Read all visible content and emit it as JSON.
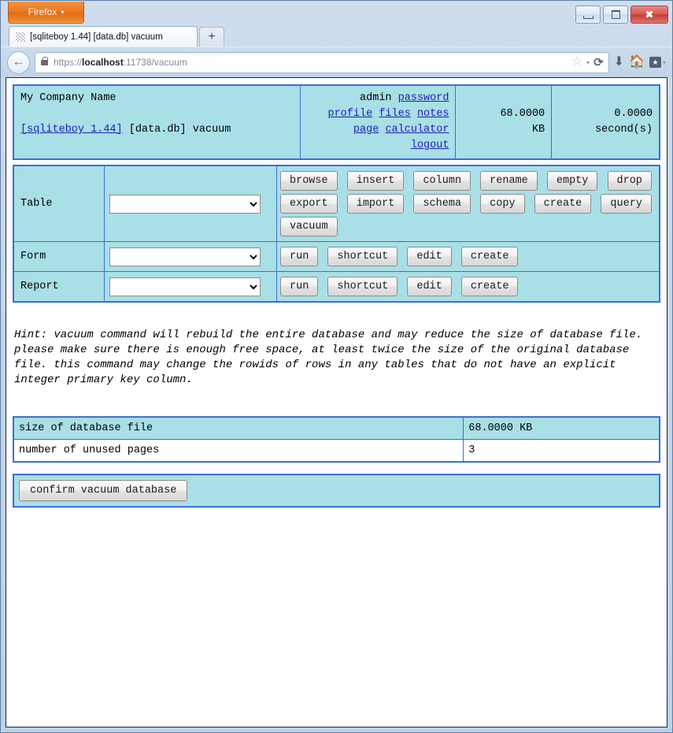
{
  "browser": {
    "app_button_label": "Firefox",
    "app_button_caret": "▾",
    "tab_title": "[sqliteboy 1.44] [data.db] vacuum",
    "new_tab_label": "+",
    "back_icon": "←",
    "url_scheme": "https://",
    "url_host": "localhost",
    "url_rest": ":11738/vacuum",
    "url_full": "https://localhost:11738/vacuum",
    "star_icon": "☆",
    "star_caret": "▾",
    "reload_icon": "⟳",
    "download_icon": "⬇",
    "home_icon": "🏠",
    "bookmark_icon": "★",
    "bookmark_caret": "▾",
    "window_controls": {
      "minimize": "minimize",
      "maximize": "maximize",
      "close": "✖"
    }
  },
  "header": {
    "company_name": "My Company Name",
    "app_link": "[sqliteboy 1.44]",
    "db_name": "[data.db]",
    "page_name": "vacuum",
    "menu_rows": [
      [
        "admin",
        "password"
      ],
      [
        "profile",
        "files",
        "notes"
      ],
      [
        "page",
        "calculator"
      ],
      [
        "logout"
      ]
    ],
    "menu_plain": [
      "admin"
    ],
    "db_size_value": "68.0000",
    "db_size_unit": "KB",
    "elapsed_value": "0.0000",
    "elapsed_unit": "second(s)"
  },
  "toolbar": {
    "rows": [
      {
        "label": "Table",
        "select_value": "",
        "buttons": [
          "browse",
          "insert",
          "column",
          "rename",
          "empty",
          "drop",
          "export",
          "import",
          "schema",
          "copy",
          "create",
          "query",
          "vacuum"
        ]
      },
      {
        "label": "Form",
        "select_value": "",
        "buttons": [
          "run",
          "shortcut",
          "edit",
          "create"
        ]
      },
      {
        "label": "Report",
        "select_value": "",
        "buttons": [
          "run",
          "shortcut",
          "edit",
          "create"
        ]
      }
    ]
  },
  "hint": {
    "text": "Hint: vacuum command will rebuild the entire database and may reduce the size of database file. please make sure there is enough free space, at least twice the size of the original database file. this command may change the rowids of rows in any tables that do not have an explicit integer primary key column."
  },
  "info_table": {
    "rows": [
      {
        "key": "size of database file",
        "value": "68.0000 KB"
      },
      {
        "key": "number of unused pages",
        "value": "3"
      }
    ]
  },
  "confirm": {
    "button_label": "confirm vacuum database"
  },
  "colors": {
    "panel_bg": "#a9dfe6",
    "panel_border": "#3b6fd4",
    "link": "#1d1dbb",
    "firefox_orange": "#e8761e"
  }
}
